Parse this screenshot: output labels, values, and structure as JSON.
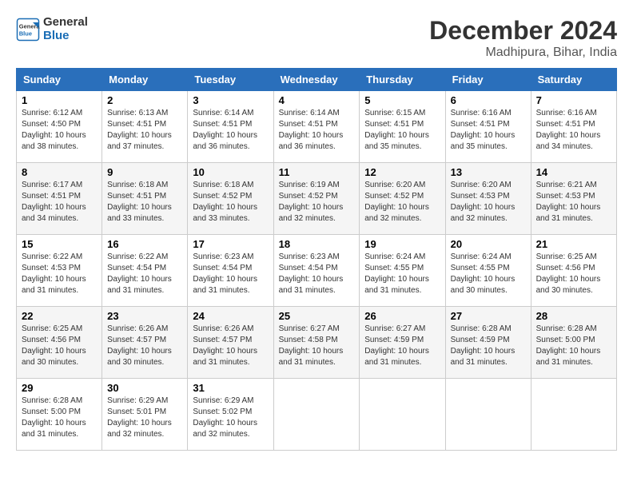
{
  "header": {
    "logo_line1": "General",
    "logo_line2": "Blue",
    "month": "December 2024",
    "location": "Madhipura, Bihar, India"
  },
  "weekdays": [
    "Sunday",
    "Monday",
    "Tuesday",
    "Wednesday",
    "Thursday",
    "Friday",
    "Saturday"
  ],
  "weeks": [
    [
      {
        "day": "1",
        "info": "Sunrise: 6:12 AM\nSunset: 4:50 PM\nDaylight: 10 hours\nand 38 minutes."
      },
      {
        "day": "2",
        "info": "Sunrise: 6:13 AM\nSunset: 4:51 PM\nDaylight: 10 hours\nand 37 minutes."
      },
      {
        "day": "3",
        "info": "Sunrise: 6:14 AM\nSunset: 4:51 PM\nDaylight: 10 hours\nand 36 minutes."
      },
      {
        "day": "4",
        "info": "Sunrise: 6:14 AM\nSunset: 4:51 PM\nDaylight: 10 hours\nand 36 minutes."
      },
      {
        "day": "5",
        "info": "Sunrise: 6:15 AM\nSunset: 4:51 PM\nDaylight: 10 hours\nand 35 minutes."
      },
      {
        "day": "6",
        "info": "Sunrise: 6:16 AM\nSunset: 4:51 PM\nDaylight: 10 hours\nand 35 minutes."
      },
      {
        "day": "7",
        "info": "Sunrise: 6:16 AM\nSunset: 4:51 PM\nDaylight: 10 hours\nand 34 minutes."
      }
    ],
    [
      {
        "day": "8",
        "info": "Sunrise: 6:17 AM\nSunset: 4:51 PM\nDaylight: 10 hours\nand 34 minutes."
      },
      {
        "day": "9",
        "info": "Sunrise: 6:18 AM\nSunset: 4:51 PM\nDaylight: 10 hours\nand 33 minutes."
      },
      {
        "day": "10",
        "info": "Sunrise: 6:18 AM\nSunset: 4:52 PM\nDaylight: 10 hours\nand 33 minutes."
      },
      {
        "day": "11",
        "info": "Sunrise: 6:19 AM\nSunset: 4:52 PM\nDaylight: 10 hours\nand 32 minutes."
      },
      {
        "day": "12",
        "info": "Sunrise: 6:20 AM\nSunset: 4:52 PM\nDaylight: 10 hours\nand 32 minutes."
      },
      {
        "day": "13",
        "info": "Sunrise: 6:20 AM\nSunset: 4:53 PM\nDaylight: 10 hours\nand 32 minutes."
      },
      {
        "day": "14",
        "info": "Sunrise: 6:21 AM\nSunset: 4:53 PM\nDaylight: 10 hours\nand 31 minutes."
      }
    ],
    [
      {
        "day": "15",
        "info": "Sunrise: 6:22 AM\nSunset: 4:53 PM\nDaylight: 10 hours\nand 31 minutes."
      },
      {
        "day": "16",
        "info": "Sunrise: 6:22 AM\nSunset: 4:54 PM\nDaylight: 10 hours\nand 31 minutes."
      },
      {
        "day": "17",
        "info": "Sunrise: 6:23 AM\nSunset: 4:54 PM\nDaylight: 10 hours\nand 31 minutes."
      },
      {
        "day": "18",
        "info": "Sunrise: 6:23 AM\nSunset: 4:54 PM\nDaylight: 10 hours\nand 31 minutes."
      },
      {
        "day": "19",
        "info": "Sunrise: 6:24 AM\nSunset: 4:55 PM\nDaylight: 10 hours\nand 31 minutes."
      },
      {
        "day": "20",
        "info": "Sunrise: 6:24 AM\nSunset: 4:55 PM\nDaylight: 10 hours\nand 30 minutes."
      },
      {
        "day": "21",
        "info": "Sunrise: 6:25 AM\nSunset: 4:56 PM\nDaylight: 10 hours\nand 30 minutes."
      }
    ],
    [
      {
        "day": "22",
        "info": "Sunrise: 6:25 AM\nSunset: 4:56 PM\nDaylight: 10 hours\nand 30 minutes."
      },
      {
        "day": "23",
        "info": "Sunrise: 6:26 AM\nSunset: 4:57 PM\nDaylight: 10 hours\nand 30 minutes."
      },
      {
        "day": "24",
        "info": "Sunrise: 6:26 AM\nSunset: 4:57 PM\nDaylight: 10 hours\nand 31 minutes."
      },
      {
        "day": "25",
        "info": "Sunrise: 6:27 AM\nSunset: 4:58 PM\nDaylight: 10 hours\nand 31 minutes."
      },
      {
        "day": "26",
        "info": "Sunrise: 6:27 AM\nSunset: 4:59 PM\nDaylight: 10 hours\nand 31 minutes."
      },
      {
        "day": "27",
        "info": "Sunrise: 6:28 AM\nSunset: 4:59 PM\nDaylight: 10 hours\nand 31 minutes."
      },
      {
        "day": "28",
        "info": "Sunrise: 6:28 AM\nSunset: 5:00 PM\nDaylight: 10 hours\nand 31 minutes."
      }
    ],
    [
      {
        "day": "29",
        "info": "Sunrise: 6:28 AM\nSunset: 5:00 PM\nDaylight: 10 hours\nand 31 minutes."
      },
      {
        "day": "30",
        "info": "Sunrise: 6:29 AM\nSunset: 5:01 PM\nDaylight: 10 hours\nand 32 minutes."
      },
      {
        "day": "31",
        "info": "Sunrise: 6:29 AM\nSunset: 5:02 PM\nDaylight: 10 hours\nand 32 minutes."
      },
      null,
      null,
      null,
      null
    ]
  ]
}
